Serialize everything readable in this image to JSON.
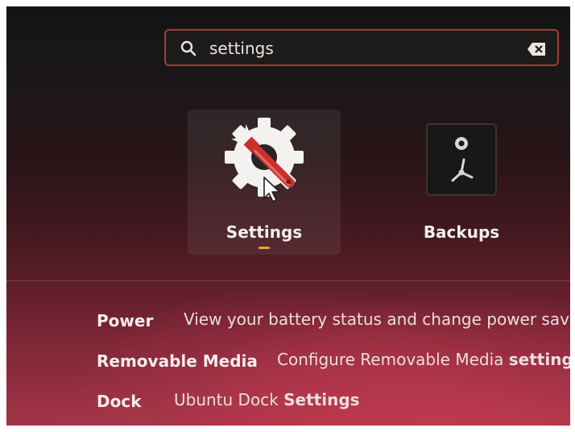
{
  "search": {
    "value": "settings",
    "icon": "search-icon",
    "clear_icon": "backspace-clear-icon"
  },
  "apps": [
    {
      "label": "Settings",
      "icon": "settings-gear-wrench-icon",
      "running": true
    },
    {
      "label": "Backups",
      "icon": "backups-safe-icon",
      "running": false
    }
  ],
  "results": [
    {
      "name": "Power",
      "desc": "View your battery status and change power saving",
      "desc_bold": ""
    },
    {
      "name": "Removable Media",
      "desc": "Configure Removable Media ",
      "desc_bold": "settings"
    },
    {
      "name": "Dock",
      "desc": "Ubuntu Dock ",
      "desc_bold": "Settings"
    }
  ],
  "colors": {
    "accent": "#e8a33a",
    "search_border": "#a83a3e"
  }
}
